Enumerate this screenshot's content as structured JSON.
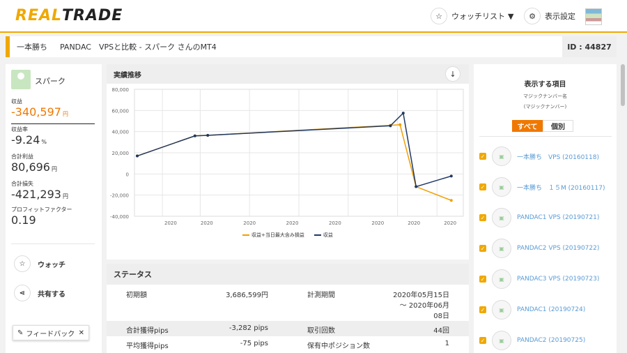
{
  "header": {
    "logo_real": "REAL",
    "logo_trade": "TRADE",
    "watchlist": "ウォッチリスト",
    "settings": "表示設定"
  },
  "breadcrumb": {
    "prefix": "一本勝ち",
    "title": "PANDAC　VPSと比較 - スパーク さんのMT4",
    "id": "ID : 44827"
  },
  "profile": {
    "name": "スパーク",
    "stats": [
      {
        "label": "収益",
        "value": "-340,597",
        "unit": "円"
      },
      {
        "label": "収益率",
        "value": "-9.24",
        "unit": "%"
      },
      {
        "label": "合計利益",
        "value": "80,696",
        "unit": "円"
      },
      {
        "label": "合計損失",
        "value": "-421,293",
        "unit": "円"
      },
      {
        "label": "プロフィットファクター",
        "value": "0.19",
        "unit": ""
      }
    ],
    "watch": "ウォッチ",
    "share": "共有する",
    "feedback": "フィードバック",
    "close": "✕"
  },
  "chart_section": {
    "title": "実績推移"
  },
  "chart_data": {
    "type": "line",
    "y_ticks": [
      "80,000",
      "60,000",
      "40,000",
      "20,000",
      "0",
      "-20,000",
      "-40,000"
    ],
    "ylim": [
      -40000,
      80000
    ],
    "x_ticks": [
      "2020",
      "2020",
      "2020",
      "2020",
      "2020",
      "2020",
      "2020",
      "2020"
    ],
    "series": [
      {
        "name": "収益+当日最大含み損益",
        "color": "#f0a000",
        "values": [
          [
            0,
            17000
          ],
          [
            0.18,
            36000
          ],
          [
            0.22,
            36500
          ],
          [
            0.79,
            46000
          ],
          [
            0.82,
            46500
          ],
          [
            0.87,
            -12000
          ],
          [
            0.98,
            -25000
          ]
        ]
      },
      {
        "name": "収益",
        "color": "#1f3864",
        "values": [
          [
            0,
            17000
          ],
          [
            0.18,
            36000
          ],
          [
            0.22,
            36500
          ],
          [
            0.79,
            45500
          ],
          [
            0.83,
            57500
          ],
          [
            0.87,
            -12000
          ],
          [
            0.98,
            -2000
          ]
        ]
      }
    ]
  },
  "status": {
    "title": "ステータス",
    "rows": [
      {
        "k1": "初期額",
        "v1": "3,686,599円",
        "k2": "計測期間",
        "v2a": "2020年05月15日",
        "v2b": "～ 2020年06月",
        "v2c": "08日"
      },
      {
        "k1": "合計獲得pips",
        "v1": "-3,282 pips",
        "k2": "取引回数",
        "v2": "44回"
      },
      {
        "k1": "平均獲得pips",
        "v1": "-75 pips",
        "k2": "保有中ポジション数",
        "v2": "1"
      }
    ]
  },
  "side": {
    "title": "表示する項目",
    "sub1": "マジックナンバー名",
    "sub2": "(マジックナンバー)",
    "all": "すべて",
    "each": "個別",
    "items": [
      "一本勝ち　VPS (20160118)",
      "一本勝ち　１５M (20160117)",
      "PANDAC1 VPS (20190721)",
      "PANDAC2 VPS (20190722)",
      "PANDAC3 VPS (20190723)",
      "PANDAC1 (20190724)",
      "PANDAC2 (20190725)"
    ]
  }
}
